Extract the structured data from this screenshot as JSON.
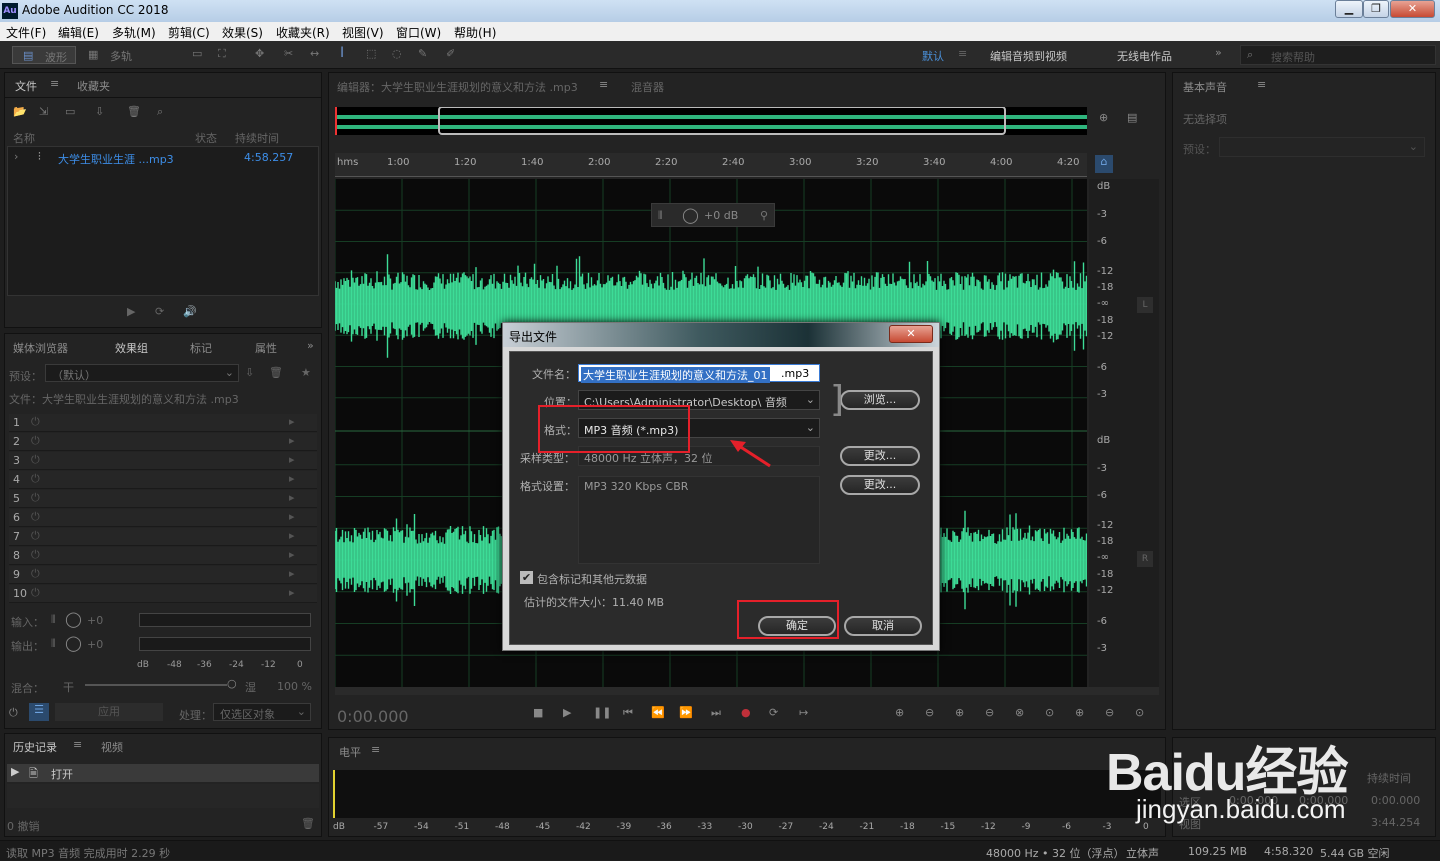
{
  "window": {
    "title": "Adobe Audition CC 2018",
    "app_icon": "Au",
    "min": "▁",
    "max": "❐",
    "close": "✕"
  },
  "menu": [
    "文件(F)",
    "编辑(E)",
    "多轨(M)",
    "剪辑(C)",
    "效果(S)",
    "收藏夹(R)",
    "视图(V)",
    "窗口(W)",
    "帮助(H)"
  ],
  "toolbar": {
    "waveform": "波形",
    "multitrack": "多轨",
    "workspaces": [
      "默认",
      "编辑音频到视频",
      "无线电作品"
    ],
    "search_placeholder": "搜索帮助",
    "more": "»"
  },
  "files_panel": {
    "tabs": [
      "文件",
      "收藏夹"
    ],
    "col_name": "名称",
    "col_status": "状态",
    "col_duration": "持续时间",
    "file_name": "大学生职业生涯 ...mp3",
    "file_duration": "4:58.257"
  },
  "effects_panel": {
    "tabs": [
      "媒体浏览器",
      "效果组",
      "标记",
      "属性"
    ],
    "preset_label": "预设：",
    "preset_value": "（默认）",
    "file_label": "文件：大学生职业生涯规划的意义和方法 .mp3",
    "rows": [
      "1",
      "2",
      "3",
      "4",
      "5",
      "6",
      "7",
      "8",
      "9",
      "10"
    ],
    "input_label": "输入：",
    "output_label": "输出：",
    "gain": "+0",
    "meter_ticks": [
      "dB",
      "-48",
      "-36",
      "-24",
      "-12",
      "0"
    ],
    "mix_label": "混合：",
    "mix_dry": "干",
    "mix_wet": "湿",
    "mix_value": "100 %",
    "apply": "应用",
    "process_label": "处理：",
    "process_value": "仅选区对象"
  },
  "history_panel": {
    "tabs": [
      "历史记录",
      "视频"
    ],
    "item": "打开",
    "undo": "0 撤销"
  },
  "status_bar": {
    "left": "读取 MP3 音频 完成用时 2.29 秒",
    "right": [
      "48000 Hz • 32 位（浮点）",
      "立体声",
      "109.25 MB",
      "4:58.320",
      "5.44 GB 空闲"
    ]
  },
  "editor": {
    "tab": "编辑器：大学生职业生涯规划的意义和方法 .mp3",
    "mixer_tab": "混音器",
    "ruler": [
      "hms",
      "1:00",
      "1:20",
      "1:40",
      "2:00",
      "2:20",
      "2:40",
      "3:00",
      "3:20",
      "3:40",
      "4:00",
      "4:20"
    ],
    "db_top": [
      "dB",
      "-3",
      "-6",
      "-12",
      "-18",
      "-∞",
      "-18",
      "-12",
      "-6",
      "-3"
    ],
    "db_bottom": [
      "dB",
      "-3",
      "-6",
      "-12",
      "-18",
      "-∞",
      "-18",
      "-12",
      "-6",
      "-3"
    ],
    "hud": "+0 dB",
    "channel_l": "L",
    "channel_r": "R",
    "time": "0:00.000"
  },
  "level_panel": {
    "tab": "电平",
    "scale": [
      "dB",
      "-57",
      "-54",
      "-51",
      "-48",
      "-45",
      "-42",
      "-39",
      "-36",
      "-33",
      "-30",
      "-27",
      "-24",
      "-21",
      "-18",
      "-15",
      "-12",
      "-9",
      "-6",
      "-3",
      "0"
    ]
  },
  "essential_sound": {
    "tab": "基本声音",
    "no_selection": "无选择项",
    "preset_label": "预设："
  },
  "selection_panel": {
    "label_start": "持续时间",
    "sel_label": "选区",
    "view_label": "视图",
    "values": [
      "0:00.000",
      "0:00.000",
      "0:00.000",
      "3:44.254"
    ]
  },
  "dialog": {
    "title": "导出文件",
    "close": "✕",
    "filename_label": "文件名：",
    "filename_value": "大学生职业生涯规划的意义和方法_01",
    "filename_ext": ".mp3",
    "location_label": "位置：",
    "location_value": "C:\\Users\\Administrator\\Desktop\\ 音频",
    "browse": "浏览...",
    "format_label": "格式：",
    "format_value": "MP3 音频 (*.mp3)",
    "sample_label": "采样类型：",
    "sample_value": "48000 Hz 立体声，32 位",
    "change1": "更改...",
    "settings_label": "格式设置：",
    "settings_value": "MP3 320 Kbps CBR",
    "change2": "更改...",
    "metadata": "包含标记和其他元数据",
    "estimate": "估计的文件大小：11.40 MB",
    "ok": "确定",
    "cancel": "取消"
  },
  "watermark": {
    "logo": "Baidu经验",
    "url": "jingyan.baidu.com"
  },
  "colors": {
    "wave": "#3ddc97",
    "accent": "#4a90d9",
    "highlight": "#e5202a"
  }
}
